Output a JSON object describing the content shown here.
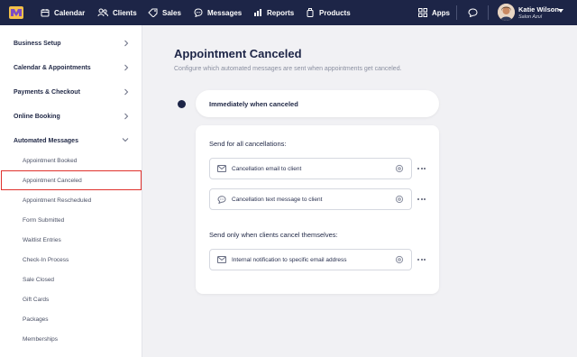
{
  "topbar": {
    "nav": [
      {
        "label": "Calendar",
        "icon": "calendar-icon"
      },
      {
        "label": "Clients",
        "icon": "clients-icon"
      },
      {
        "label": "Sales",
        "icon": "sales-tag-icon"
      },
      {
        "label": "Messages",
        "icon": "messages-icon"
      },
      {
        "label": "Reports",
        "icon": "reports-icon"
      },
      {
        "label": "Products",
        "icon": "products-icon"
      }
    ],
    "apps_label": "Apps",
    "user": {
      "name": "Katie Wilson",
      "business": "Salon Azul"
    }
  },
  "sidebar": {
    "groups": [
      {
        "label": "Business Setup"
      },
      {
        "label": "Calendar & Appointments"
      },
      {
        "label": "Payments & Checkout"
      },
      {
        "label": "Online Booking"
      },
      {
        "label": "Automated Messages"
      }
    ],
    "sub_items": [
      {
        "label": "Appointment Booked"
      },
      {
        "label": "Appointment Canceled",
        "selected": true
      },
      {
        "label": "Appointment Rescheduled"
      },
      {
        "label": "Form Submitted"
      },
      {
        "label": "Waitlist Entries"
      },
      {
        "label": "Check-In Process"
      },
      {
        "label": "Sale Closed"
      },
      {
        "label": "Gift Cards"
      },
      {
        "label": "Packages"
      },
      {
        "label": "Memberships"
      }
    ]
  },
  "main": {
    "title": "Appointment Canceled",
    "description": "Configure which automated messages are sent when appointments get canceled.",
    "trigger": "Immediately when canceled",
    "section_all": "Send for all cancellations:",
    "section_self": "Send only when clients cancel themselves:",
    "messages_all": [
      {
        "label": "Cancellation email to client",
        "icon": "email-icon"
      },
      {
        "label": "Cancellation text message to client",
        "icon": "sms-icon"
      }
    ],
    "messages_self": [
      {
        "label": "Internal notification to specific email address",
        "icon": "email-icon"
      }
    ]
  },
  "colors": {
    "nav_bg": "#1d2547",
    "highlight": "#e0312c",
    "page_bg": "#f1f1f4"
  }
}
